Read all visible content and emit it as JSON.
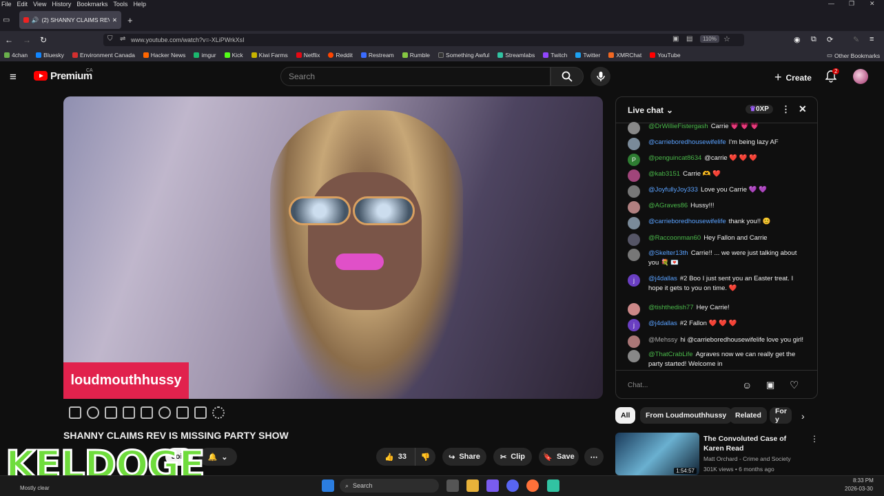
{
  "menu": {
    "items": [
      "File",
      "Edit",
      "View",
      "History",
      "Bookmarks",
      "Tools",
      "Help"
    ]
  },
  "browser": {
    "tab_title": "(2) SHANNY CLAIMS REV IS M…",
    "url": "www.youtube.com/watch?v=-XLiPWrkXsI",
    "zoom": "110%",
    "bookmarks": [
      {
        "label": "4chan",
        "color": "#6ab04c"
      },
      {
        "label": "Bluesky",
        "color": "#1185fe"
      },
      {
        "label": "Environment Canada",
        "color": "#d32f2f"
      },
      {
        "label": "Hacker News",
        "color": "#ff6600"
      },
      {
        "label": "imgur",
        "color": "#1bb76e"
      },
      {
        "label": "Kick",
        "color": "#53fc18"
      },
      {
        "label": "Kiwi Farms",
        "color": "#c8b400"
      },
      {
        "label": "Netflix",
        "color": "#e50914"
      },
      {
        "label": "Reddit",
        "color": "#ff4500"
      },
      {
        "label": "Restream",
        "color": "#3a6cff"
      },
      {
        "label": "Rumble",
        "color": "#85c742"
      },
      {
        "label": "Something Awful",
        "color": "#333333"
      },
      {
        "label": "Streamlabs",
        "color": "#31c3a2"
      },
      {
        "label": "Twitch",
        "color": "#9146ff"
      },
      {
        "label": "Twitter",
        "color": "#1da1f2"
      },
      {
        "label": "XMRChat",
        "color": "#f26822"
      },
      {
        "label": "YouTube",
        "color": "#ff0000"
      }
    ],
    "other_bookmarks": "Other Bookmarks"
  },
  "youtube": {
    "logo_text": "Premium",
    "region": "CA",
    "search_placeholder": "Search",
    "create_label": "Create",
    "notif_count": "2"
  },
  "video": {
    "overlay_name": "loudmouthhussy",
    "title": "SHANNY CLAIMS REV IS MISSING PARTY SHOW",
    "join_label": "Join",
    "like_count": "33",
    "share_label": "Share",
    "clip_label": "Clip",
    "save_label": "Save",
    "watermark": "KELDOGE"
  },
  "chat": {
    "header": "Live chat",
    "xp": "0XP",
    "input_placeholder": "Chat...",
    "messages": [
      {
        "user": "@DrWillieFistergash",
        "text": "Carrie 💗 💗 💗",
        "color": "#888"
      },
      {
        "user": "@carrieboredhousewifelife",
        "text": "I'm being lazy AF",
        "color": "#7a8a99",
        "mod": true
      },
      {
        "user": "@penguincat8634",
        "text": "@carrie ❤️ ❤️ ❤️",
        "color": "#2e7d32",
        "initial": "P"
      },
      {
        "user": "@kab3151",
        "text": "Carrie 🫶 ❤️",
        "color": "#a0457a"
      },
      {
        "user": "@JoyfullyJoy333",
        "text": "Love you Carrie 💜 💜",
        "color": "#777",
        "mod": true
      },
      {
        "user": "@AGraves86",
        "text": "Hussy!!!",
        "color": "#b08080"
      },
      {
        "user": "@carrieboredhousewifelife",
        "text": "thank you!! 😊",
        "color": "#7a8a99",
        "mod": true
      },
      {
        "user": "@Raccoonman60",
        "text": "Hey Fallon and Carrie",
        "color": "#556"
      },
      {
        "user": "@Skelter13th",
        "text": "Carrie!! ... we were just talking about you 💐 💌",
        "color": "#777",
        "mod": true
      },
      {
        "user": "@j4dallas",
        "text": "#2 Boo I just sent you an Easter treat. I hope it gets to you on time. ❤️",
        "color": "#6a3fc2",
        "initial": "j",
        "mod": true
      },
      {
        "user": "@tishthedish77",
        "text": "Hey Carrie!",
        "color": "#c88"
      },
      {
        "user": "@j4dallas",
        "text": "#2 Fallon ❤️ ❤️ ❤️",
        "color": "#6a3fc2",
        "initial": "j",
        "mod": true
      },
      {
        "user": "@Mehssy",
        "text": "hi @carrieboredhousewifelife love you girl!",
        "color": "#a77"
      },
      {
        "user": "@ThatCrabLife",
        "text": "Agraves now we can really get the party started! Welcome in",
        "color": "#888"
      }
    ]
  },
  "filters": [
    "All",
    "From Loudmouthhussy",
    "Related",
    "For y"
  ],
  "related": {
    "title": "The Convoluted Case of Karen Read",
    "channel": "Matt Orchard - Crime and Society",
    "meta": "301K views • 6 months ago",
    "duration": "1:54:57"
  },
  "taskbar": {
    "weather": "Mostly clear",
    "search_label": "Search",
    "time": "8:33 PM",
    "date": "2026-03-30"
  }
}
